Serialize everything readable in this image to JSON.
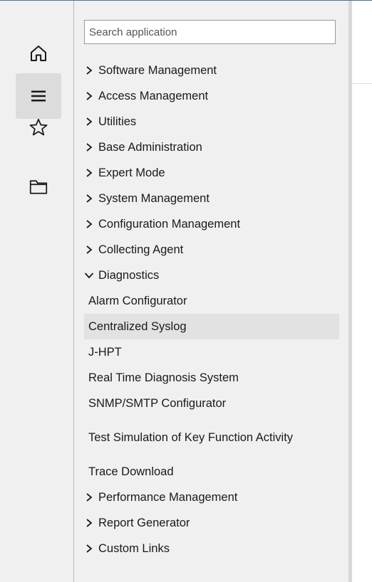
{
  "rail": {
    "items": [
      {
        "name": "home",
        "icon": "home-icon",
        "active": false
      },
      {
        "name": "menu",
        "icon": "hamburger-menu-icon",
        "active": true
      },
      {
        "name": "favorites",
        "icon": "star-icon",
        "active": false
      },
      {
        "name": "folder",
        "icon": "folder-icon",
        "active": false
      }
    ]
  },
  "search": {
    "placeholder": "Search application",
    "value": ""
  },
  "menu": {
    "top_items": [
      {
        "label": "Software Management"
      },
      {
        "label": "Access Management"
      },
      {
        "label": "Utilities"
      },
      {
        "label": "Base Administration"
      },
      {
        "label": "Expert Mode"
      },
      {
        "label": "System Management"
      },
      {
        "label": "Configuration Management"
      },
      {
        "label": "Collecting Agent"
      }
    ],
    "expanded": {
      "label": "Diagnostics",
      "children": [
        {
          "label": "Alarm Configurator"
        },
        {
          "label": "Centralized Syslog"
        },
        {
          "label": "J-HPT"
        },
        {
          "label": "Real Time Diagnosis System"
        },
        {
          "label": "SNMP/SMTP Configurator"
        },
        {
          "label": "Test Simulation of Key Function Activity"
        },
        {
          "label": "Trace Download"
        }
      ]
    },
    "bottom_items": [
      {
        "label": "Performance Management"
      },
      {
        "label": "Report Generator"
      },
      {
        "label": "Custom Links"
      }
    ]
  },
  "colors": {
    "background": "#f0f0f0",
    "selected": "#e2e2e2",
    "active_rail": "#dcdcdc",
    "top_accent": "#4a6fa0"
  }
}
